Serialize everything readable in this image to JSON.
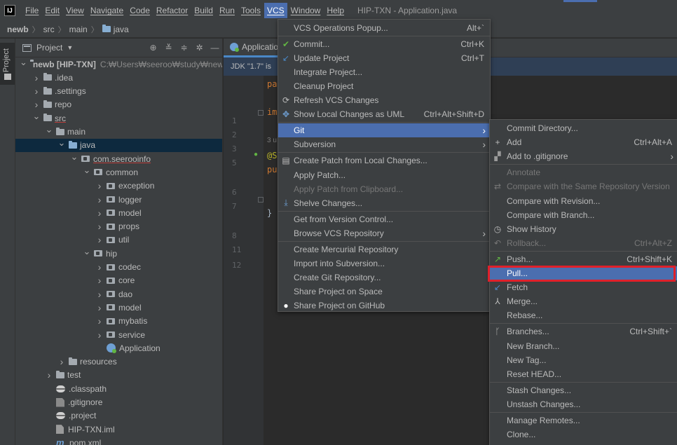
{
  "menubar": {
    "logo": "IJ",
    "items": [
      "File",
      "Edit",
      "View",
      "Navigate",
      "Code",
      "Refactor",
      "Build",
      "Run",
      "Tools",
      "VCS",
      "Window",
      "Help"
    ],
    "active": "VCS",
    "window_title": "HIP-TXN - Application.java"
  },
  "breadcrumb": [
    "newb",
    "src",
    "main",
    "java"
  ],
  "tool_stripe": {
    "project_label": "Project"
  },
  "project_panel": {
    "title": "Project",
    "tree": [
      {
        "label": "newb [HIP-TXN]",
        "extra": "C:₩Users₩seeroo₩study₩newb",
        "depth": 0,
        "twisty": "open",
        "icon": "module"
      },
      {
        "label": ".idea",
        "depth": 1,
        "twisty": "closed",
        "icon": "folder"
      },
      {
        "label": ".settings",
        "depth": 1,
        "twisty": "closed",
        "icon": "folder"
      },
      {
        "label": "repo",
        "depth": 1,
        "twisty": "closed",
        "icon": "folder"
      },
      {
        "label": "src",
        "depth": 1,
        "twisty": "open",
        "icon": "folder",
        "link": true
      },
      {
        "label": "main",
        "depth": 2,
        "twisty": "open",
        "icon": "folder"
      },
      {
        "label": "java",
        "depth": 3,
        "twisty": "open",
        "icon": "blue-folder",
        "selected": true
      },
      {
        "label": "com.seerooinfo",
        "depth": 4,
        "twisty": "open",
        "icon": "package",
        "link": true
      },
      {
        "label": "common",
        "depth": 5,
        "twisty": "open",
        "icon": "package"
      },
      {
        "label": "exception",
        "depth": 6,
        "twisty": "closed",
        "icon": "package"
      },
      {
        "label": "logger",
        "depth": 6,
        "twisty": "closed",
        "icon": "package"
      },
      {
        "label": "model",
        "depth": 6,
        "twisty": "closed",
        "icon": "package"
      },
      {
        "label": "props",
        "depth": 6,
        "twisty": "closed",
        "icon": "package"
      },
      {
        "label": "util",
        "depth": 6,
        "twisty": "closed",
        "icon": "package"
      },
      {
        "label": "hip",
        "depth": 5,
        "twisty": "open",
        "icon": "package"
      },
      {
        "label": "codec",
        "depth": 6,
        "twisty": "closed",
        "icon": "package"
      },
      {
        "label": "core",
        "depth": 6,
        "twisty": "closed",
        "icon": "package"
      },
      {
        "label": "dao",
        "depth": 6,
        "twisty": "closed",
        "icon": "package"
      },
      {
        "label": "model",
        "depth": 6,
        "twisty": "closed",
        "icon": "package"
      },
      {
        "label": "mybatis",
        "depth": 6,
        "twisty": "closed",
        "icon": "package"
      },
      {
        "label": "service",
        "depth": 6,
        "twisty": "closed",
        "icon": "package"
      },
      {
        "label": "Application",
        "depth": 6,
        "twisty": "none",
        "icon": "app-class"
      },
      {
        "label": "resources",
        "depth": 3,
        "twisty": "closed",
        "icon": "resources-folder"
      },
      {
        "label": "test",
        "depth": 2,
        "twisty": "closed",
        "icon": "folder"
      },
      {
        "label": ".classpath",
        "depth": 2,
        "twisty": "none",
        "icon": "classpath"
      },
      {
        "label": ".gitignore",
        "depth": 2,
        "twisty": "none",
        "icon": "gitignore"
      },
      {
        "label": ".project",
        "depth": 2,
        "twisty": "none",
        "icon": "classpath"
      },
      {
        "label": "HIP-TXN.iml",
        "depth": 2,
        "twisty": "none",
        "icon": "iml"
      },
      {
        "label": "pom.xml",
        "depth": 2,
        "twisty": "none",
        "icon": "maven"
      }
    ]
  },
  "editor": {
    "tab_label": "Applicatio",
    "notice": "JDK \"1.7\" is",
    "lines": [
      {
        "num": "1",
        "text": "pa",
        "style": "keyword"
      },
      {
        "num": "2",
        "text": ""
      },
      {
        "num": "3",
        "text": "im",
        "style": "keyword"
      },
      {
        "num": "5",
        "text": ""
      },
      {
        "num": "",
        "text": "3 u",
        "style": "hint"
      },
      {
        "num": "6",
        "text": "@S",
        "style": "anno"
      },
      {
        "num": "7",
        "text": "pu",
        "style": "keyword"
      },
      {
        "num": "",
        "text": ""
      },
      {
        "num": "8",
        "text": ""
      },
      {
        "num": "11",
        "text": "}",
        "style": "plain"
      },
      {
        "num": "12",
        "text": ""
      }
    ]
  },
  "vcs_menu": {
    "items": [
      {
        "label": "VCS Operations Popup...",
        "shortcut": "Alt+`"
      },
      {
        "label": "Commit...",
        "shortcut": "Ctrl+K",
        "icon": "check-icon"
      },
      {
        "label": "Update Project",
        "shortcut": "Ctrl+T",
        "icon": "update-icon"
      },
      {
        "label": "Integrate Project..."
      },
      {
        "label": "Cleanup Project"
      },
      {
        "label": "Refresh VCS Changes",
        "icon": "refresh-icon"
      },
      {
        "label": "Show Local Changes as UML",
        "shortcut": "Ctrl+Alt+Shift+D",
        "icon": "uml-icon"
      },
      {
        "label": "Git",
        "submenu": true,
        "highlighted": true
      },
      {
        "label": "Subversion",
        "submenu": true
      },
      {
        "label": "Create Patch from Local Changes...",
        "icon": "patch-icon"
      },
      {
        "label": "Apply Patch..."
      },
      {
        "label": "Apply Patch from Clipboard...",
        "disabled": true
      },
      {
        "label": "Shelve Changes...",
        "icon": "shelve-icon"
      },
      {
        "label": "Get from Version Control..."
      },
      {
        "label": "Browse VCS Repository",
        "submenu": true
      },
      {
        "label": "Create Mercurial Repository"
      },
      {
        "label": "Import into Subversion..."
      },
      {
        "label": "Create Git Repository..."
      },
      {
        "label": "Share Project on Space"
      },
      {
        "label": "Share Project on GitHub",
        "icon": "github-icon"
      }
    ]
  },
  "git_menu": {
    "items": [
      {
        "label": "Commit Directory..."
      },
      {
        "label": "Add",
        "shortcut": "Ctrl+Alt+A",
        "icon": "plus-icon"
      },
      {
        "label": "Add to .gitignore",
        "submenu": true,
        "icon": "gitignore-icon"
      },
      {
        "label": "Annotate",
        "disabled": true
      },
      {
        "label": "Compare with the Same Repository Version",
        "disabled": true,
        "icon": "compare-icon"
      },
      {
        "label": "Compare with Revision..."
      },
      {
        "label": "Compare with Branch..."
      },
      {
        "label": "Show History",
        "icon": "history-icon"
      },
      {
        "label": "Rollback...",
        "shortcut": "Ctrl+Alt+Z",
        "disabled": true,
        "icon": "rollback-icon"
      },
      {
        "label": "Push...",
        "shortcut": "Ctrl+Shift+K",
        "icon": "push-icon"
      },
      {
        "label": "Pull...",
        "highlighted": true
      },
      {
        "label": "Fetch",
        "icon": "fetch-icon"
      },
      {
        "label": "Merge...",
        "icon": "merge-icon"
      },
      {
        "label": "Rebase..."
      },
      {
        "label": "Branches...",
        "shortcut": "Ctrl+Shift+`",
        "icon": "branch-icon"
      },
      {
        "label": "New Branch..."
      },
      {
        "label": "New Tag..."
      },
      {
        "label": "Reset HEAD..."
      },
      {
        "label": "Stash Changes..."
      },
      {
        "label": "Unstash Changes..."
      },
      {
        "label": "Manage Remotes..."
      },
      {
        "label": "Clone..."
      }
    ]
  },
  "colors": {
    "menu_bg": "#3c3f41",
    "highlight": "#4b6eaf",
    "annotation_box": "#e0202a",
    "editor_bg": "#2b2b2b"
  }
}
